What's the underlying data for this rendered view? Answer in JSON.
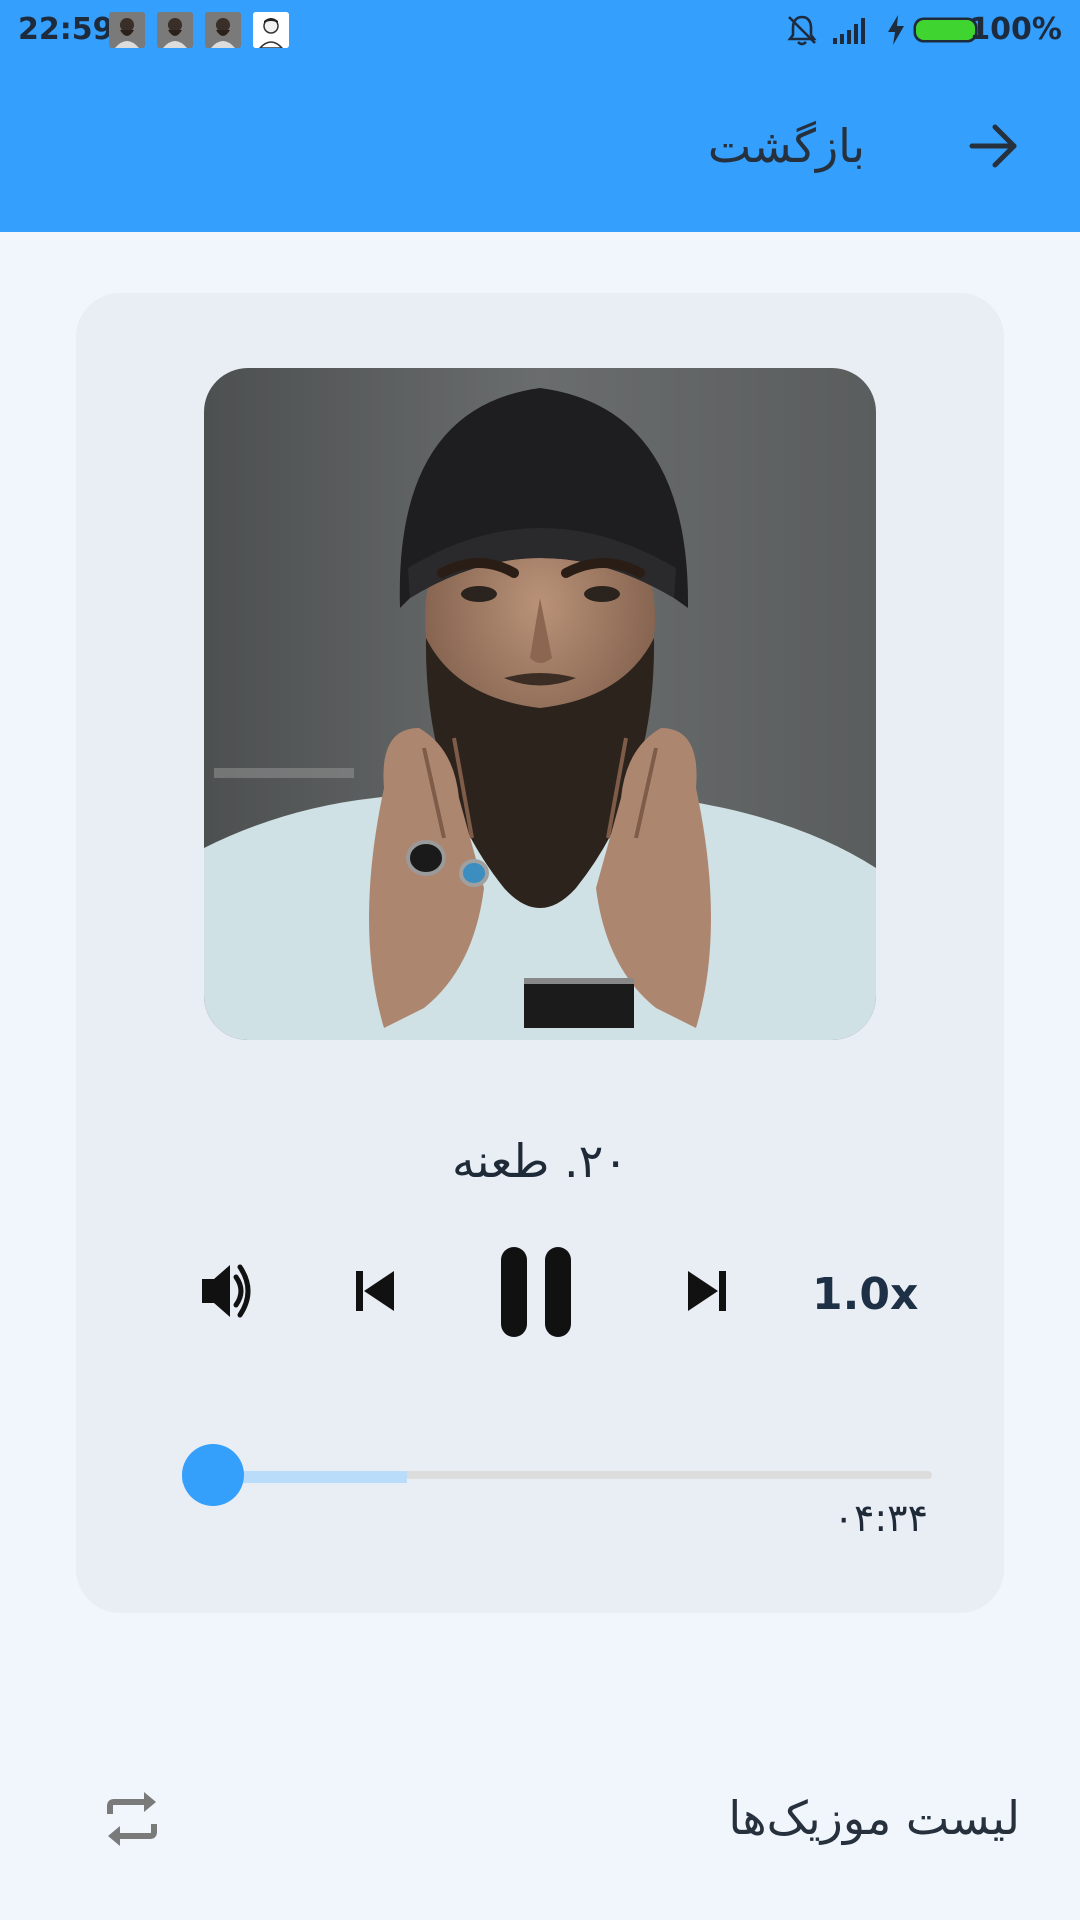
{
  "status_bar": {
    "time": "22:59",
    "battery_percent": "100%",
    "battery_level": 1.0,
    "notification_icons": [
      "avatar-icon",
      "avatar-icon",
      "avatar-icon",
      "avatar-icon"
    ],
    "system_icons": [
      "bell-off-icon",
      "signal-icon",
      "charging-icon",
      "battery-icon"
    ]
  },
  "header": {
    "back_label": "بازگشت",
    "back_icon": "arrow-right-icon"
  },
  "player": {
    "track_title": "۲۰. طعنه",
    "speed_label": "1.0x",
    "time_label": "۰۴:۳۴",
    "progress": 0.0,
    "buffered": 0.3,
    "controls": {
      "volume_icon": "volume-icon",
      "previous_icon": "skip-previous-icon",
      "pause_icon": "pause-icon",
      "next_icon": "skip-next-icon"
    }
  },
  "footer": {
    "playlist_label": "لیست موزیک‌ها",
    "repeat_icon": "repeat-icon"
  },
  "colors": {
    "primary": "#359ffd",
    "background": "#f1f6fd",
    "card": "#e9edf4",
    "text_dark": "#1f2a38"
  }
}
